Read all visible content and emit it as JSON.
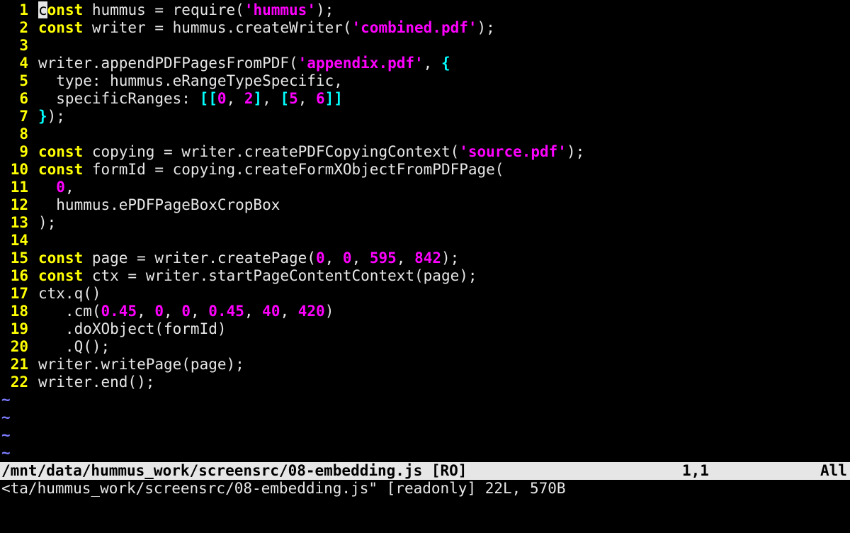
{
  "colors": {
    "background": "#000000",
    "foreground": "#e6e6e6",
    "line_number": "#ffff00",
    "keyword": "#ffff00",
    "string": "#ff00ff",
    "number": "#ff00ff",
    "bracket": "#00ffff",
    "tilde": "#7b7bff",
    "statusline_bg": "#e6e6e6"
  },
  "lines": [
    {
      "n": "1",
      "tokens": [
        {
          "t": "c",
          "c": "cursor"
        },
        {
          "t": "onst",
          "c": "kw"
        },
        {
          "t": " hummus = require(",
          "c": "plain"
        },
        {
          "t": "'hummus'",
          "c": "str"
        },
        {
          "t": ");",
          "c": "plain"
        }
      ]
    },
    {
      "n": "2",
      "tokens": [
        {
          "t": "const",
          "c": "kw"
        },
        {
          "t": " writer = hummus.createWriter(",
          "c": "plain"
        },
        {
          "t": "'combined.pdf'",
          "c": "str"
        },
        {
          "t": ");",
          "c": "plain"
        }
      ]
    },
    {
      "n": "3",
      "tokens": []
    },
    {
      "n": "4",
      "tokens": [
        {
          "t": "writer.appendPDFPagesFromPDF(",
          "c": "plain"
        },
        {
          "t": "'appendix.pdf'",
          "c": "str"
        },
        {
          "t": ", ",
          "c": "plain"
        },
        {
          "t": "{",
          "c": "br"
        }
      ]
    },
    {
      "n": "5",
      "tokens": [
        {
          "t": "  type: hummus.eRangeTypeSpecific,",
          "c": "plain"
        }
      ]
    },
    {
      "n": "6",
      "tokens": [
        {
          "t": "  specificRanges: ",
          "c": "plain"
        },
        {
          "t": "[[",
          "c": "br"
        },
        {
          "t": "0",
          "c": "num"
        },
        {
          "t": ", ",
          "c": "plain"
        },
        {
          "t": "2",
          "c": "num"
        },
        {
          "t": "]",
          "c": "br"
        },
        {
          "t": ", ",
          "c": "plain"
        },
        {
          "t": "[",
          "c": "br"
        },
        {
          "t": "5",
          "c": "num"
        },
        {
          "t": ", ",
          "c": "plain"
        },
        {
          "t": "6",
          "c": "num"
        },
        {
          "t": "]]",
          "c": "br"
        }
      ]
    },
    {
      "n": "7",
      "tokens": [
        {
          "t": "}",
          "c": "br"
        },
        {
          "t": ");",
          "c": "plain"
        }
      ]
    },
    {
      "n": "8",
      "tokens": []
    },
    {
      "n": "9",
      "tokens": [
        {
          "t": "const",
          "c": "kw"
        },
        {
          "t": " copying = writer.createPDFCopyingContext(",
          "c": "plain"
        },
        {
          "t": "'source.pdf'",
          "c": "str"
        },
        {
          "t": ");",
          "c": "plain"
        }
      ]
    },
    {
      "n": "10",
      "tokens": [
        {
          "t": "const",
          "c": "kw"
        },
        {
          "t": " formId = copying.createFormXObjectFromPDFPage(",
          "c": "plain"
        }
      ]
    },
    {
      "n": "11",
      "tokens": [
        {
          "t": "  ",
          "c": "plain"
        },
        {
          "t": "0",
          "c": "num"
        },
        {
          "t": ",",
          "c": "plain"
        }
      ]
    },
    {
      "n": "12",
      "tokens": [
        {
          "t": "  hummus.ePDFPageBoxCropBox",
          "c": "plain"
        }
      ]
    },
    {
      "n": "13",
      "tokens": [
        {
          "t": ");",
          "c": "plain"
        }
      ]
    },
    {
      "n": "14",
      "tokens": []
    },
    {
      "n": "15",
      "tokens": [
        {
          "t": "const",
          "c": "kw"
        },
        {
          "t": " page = writer.createPage(",
          "c": "plain"
        },
        {
          "t": "0",
          "c": "num"
        },
        {
          "t": ", ",
          "c": "plain"
        },
        {
          "t": "0",
          "c": "num"
        },
        {
          "t": ", ",
          "c": "plain"
        },
        {
          "t": "595",
          "c": "num"
        },
        {
          "t": ", ",
          "c": "plain"
        },
        {
          "t": "842",
          "c": "num"
        },
        {
          "t": ");",
          "c": "plain"
        }
      ]
    },
    {
      "n": "16",
      "tokens": [
        {
          "t": "const",
          "c": "kw"
        },
        {
          "t": " ctx = writer.startPageContentContext(page);",
          "c": "plain"
        }
      ]
    },
    {
      "n": "17",
      "tokens": [
        {
          "t": "ctx.q()",
          "c": "plain"
        }
      ]
    },
    {
      "n": "18",
      "tokens": [
        {
          "t": "   .cm(",
          "c": "plain"
        },
        {
          "t": "0.45",
          "c": "num"
        },
        {
          "t": ", ",
          "c": "plain"
        },
        {
          "t": "0",
          "c": "num"
        },
        {
          "t": ", ",
          "c": "plain"
        },
        {
          "t": "0",
          "c": "num"
        },
        {
          "t": ", ",
          "c": "plain"
        },
        {
          "t": "0.45",
          "c": "num"
        },
        {
          "t": ", ",
          "c": "plain"
        },
        {
          "t": "40",
          "c": "num"
        },
        {
          "t": ", ",
          "c": "plain"
        },
        {
          "t": "420",
          "c": "num"
        },
        {
          "t": ")",
          "c": "plain"
        }
      ]
    },
    {
      "n": "19",
      "tokens": [
        {
          "t": "   .doXObject(formId)",
          "c": "plain"
        }
      ]
    },
    {
      "n": "20",
      "tokens": [
        {
          "t": "   .Q();",
          "c": "plain"
        }
      ]
    },
    {
      "n": "21",
      "tokens": [
        {
          "t": "writer.writePage(page);",
          "c": "plain"
        }
      ]
    },
    {
      "n": "22",
      "tokens": [
        {
          "t": "writer.end();",
          "c": "plain"
        }
      ]
    }
  ],
  "tildes": [
    "~",
    "~",
    "~",
    "~"
  ],
  "statusline": {
    "file": "/mnt/data/hummus_work/screensrc/08-embedding.js [RO]",
    "position": "1,1",
    "percent": "All"
  },
  "message": "<ta/hummus_work/screensrc/08-embedding.js\" [readonly] 22L, 570B"
}
